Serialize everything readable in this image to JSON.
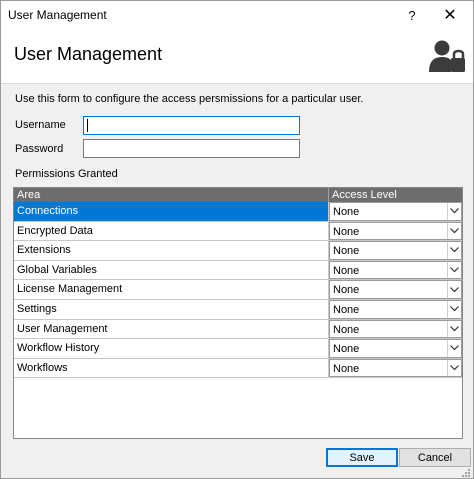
{
  "window": {
    "title": "User Management",
    "help_label": "?",
    "close_label": "✕"
  },
  "header": {
    "heading": "User Management",
    "icon": "user-lock-icon"
  },
  "form": {
    "intro": "Use this form to configure the access persmissions for a particular user.",
    "username_label": "Username",
    "username_value": "",
    "password_label": "Password",
    "password_value": ""
  },
  "permissions": {
    "label": "Permissions Granted",
    "columns": [
      "Area",
      "Access Level"
    ],
    "rows": [
      {
        "area": "Connections",
        "access": "None",
        "selected": true
      },
      {
        "area": "Encrypted Data",
        "access": "None"
      },
      {
        "area": "Extensions",
        "access": "None"
      },
      {
        "area": "Global Variables",
        "access": "None"
      },
      {
        "area": "License Management",
        "access": "None"
      },
      {
        "area": "Settings",
        "access": "None"
      },
      {
        "area": "User Management",
        "access": "None"
      },
      {
        "area": "Workflow History",
        "access": "None"
      },
      {
        "area": "Workflows",
        "access": "None"
      }
    ]
  },
  "buttons": {
    "save": "Save",
    "cancel": "Cancel"
  },
  "colors": {
    "selection": "#0078d7",
    "grid_header": "#6d6d6d",
    "window_bg": "#f0f0f0"
  }
}
